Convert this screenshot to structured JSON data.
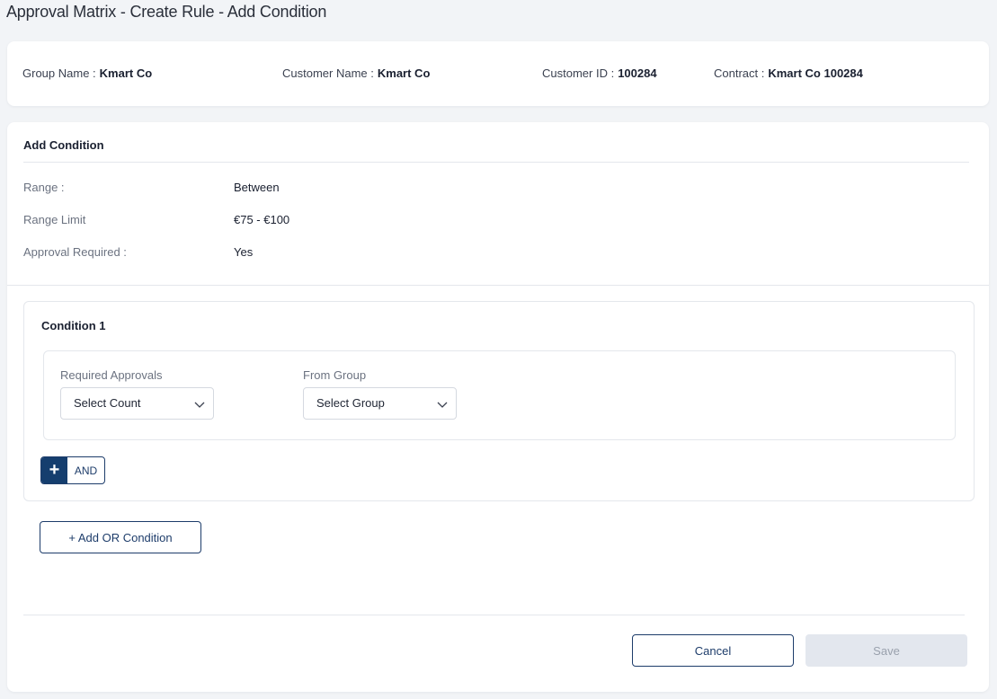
{
  "page": {
    "title": "Approval Matrix - Create Rule - Add Condition"
  },
  "info": {
    "group_name_label": "Group Name :",
    "group_name": "Kmart Co",
    "customer_name_label": "Customer Name :",
    "customer_name": "Kmart Co",
    "customer_id_label": "Customer ID :",
    "customer_id": "100284",
    "contract_label": "Contract :",
    "contract": "Kmart Co 100284"
  },
  "add_condition": {
    "title": "Add Condition",
    "range_label": "Range :",
    "range_value": "Between",
    "range_limit_label": "Range Limit",
    "range_limit_value": "€75 - €100",
    "approval_required_label": "Approval Required :",
    "approval_required_value": "Yes"
  },
  "condition": {
    "title": "Condition 1",
    "required_approvals_label": "Required Approvals",
    "required_approvals_value": "Select Count",
    "from_group_label": "From Group",
    "from_group_value": "Select Group",
    "and_plus": "+",
    "and_label": "AND"
  },
  "actions": {
    "add_or_label": "+ Add OR Condition",
    "cancel_label": "Cancel",
    "save_label": "Save"
  },
  "colors": {
    "primary": "#153e6e",
    "disabled_bg": "#e3e7ee",
    "background": "#f2f4f7"
  }
}
